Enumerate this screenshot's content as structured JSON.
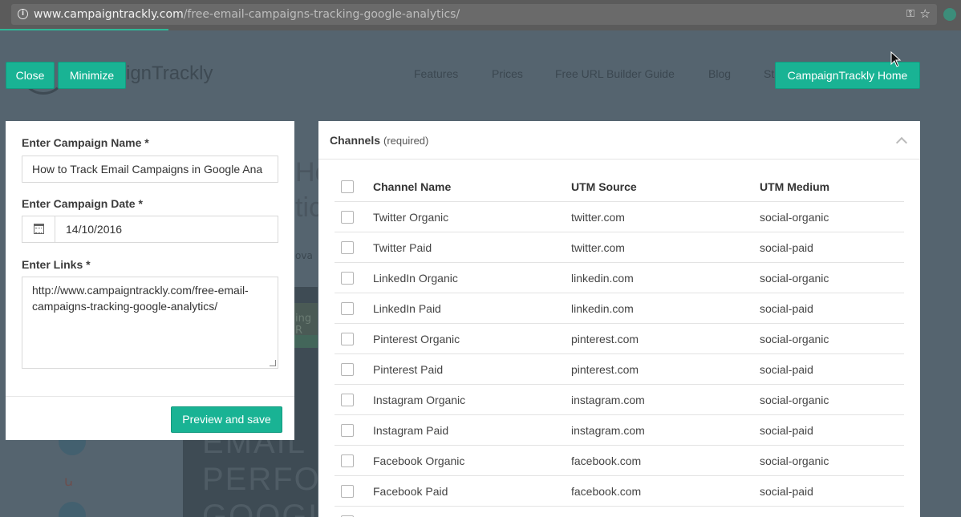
{
  "browser": {
    "url_host": "www.campaigntrackly.com",
    "url_path": "/free-email-campaigns-tracking-google-analytics/"
  },
  "background": {
    "logo_text": "ignTrackly",
    "nav": [
      "Features",
      "Prices",
      "Free URL Builder Guide",
      "Blog",
      "St"
    ],
    "title_lines": [
      "Ho",
      "tic"
    ],
    "author_fragment": "ova",
    "banner_fragment": "ing R",
    "hero_lines": [
      "T",
      "EMAIL",
      "PERFO",
      "GOOGL"
    ]
  },
  "buttons": {
    "close": "Close",
    "minimize": "Minimize",
    "home": "CampaignTrackly Home",
    "preview": "Preview and save"
  },
  "form": {
    "campaign_name_label": "Enter Campaign Name *",
    "campaign_name_value": "How to Track Email Campaigns in Google Ana",
    "campaign_date_label": "Enter Campaign Date *",
    "campaign_date_value": "14/10/2016",
    "links_label": "Enter Links *",
    "links_value": "http://www.campaigntrackly.com/free-email-campaigns-tracking-google-analytics/"
  },
  "channels": {
    "title": "Channels",
    "subtitle": "(required)",
    "columns": [
      "Channel Name",
      "UTM Source",
      "UTM Medium"
    ],
    "rows": [
      {
        "name": "Twitter Organic",
        "source": "twitter.com",
        "medium": "social-organic"
      },
      {
        "name": "Twitter Paid",
        "source": "twitter.com",
        "medium": "social-paid"
      },
      {
        "name": "LinkedIn Organic",
        "source": "linkedin.com",
        "medium": "social-organic"
      },
      {
        "name": "LinkedIn Paid",
        "source": "linkedin.com",
        "medium": "social-paid"
      },
      {
        "name": "Pinterest Organic",
        "source": "pinterest.com",
        "medium": "social-organic"
      },
      {
        "name": "Pinterest Paid",
        "source": "pinterest.com",
        "medium": "social-paid"
      },
      {
        "name": "Instagram Organic",
        "source": "instagram.com",
        "medium": "social-organic"
      },
      {
        "name": "Instagram Paid",
        "source": "instagram.com",
        "medium": "social-paid"
      },
      {
        "name": "Facebook Organic",
        "source": "facebook.com",
        "medium": "social-organic"
      },
      {
        "name": "Facebook Paid",
        "source": "facebook.com",
        "medium": "social-paid"
      }
    ]
  },
  "colors": {
    "accent": "#19b394",
    "overlay": "#55646f"
  }
}
